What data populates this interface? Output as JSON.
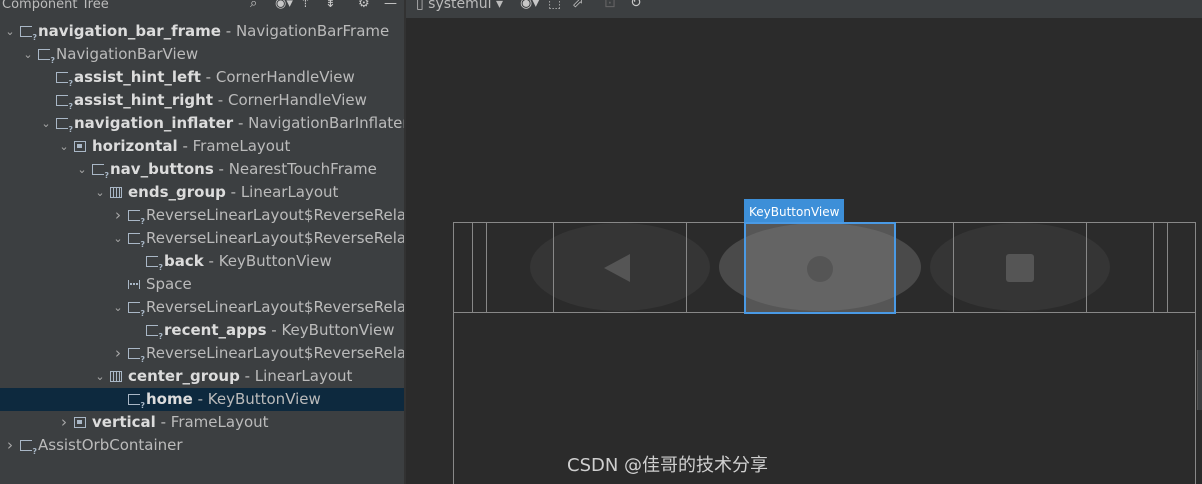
{
  "tree_panel": {
    "title": "Component Tree",
    "header_icons": [
      "search-icon",
      "eye-icon",
      "expand-all-icon",
      "collapse-all-icon",
      "gear-icon",
      "minimize-icon"
    ],
    "nodes": [
      {
        "id": "navigation_bar_frame",
        "type": "NavigationBarFrame",
        "depth": 0,
        "chevron": "down",
        "icon": "view"
      },
      {
        "id": "",
        "type": "NavigationBarView",
        "depth": 1,
        "chevron": "down",
        "icon": "view"
      },
      {
        "id": "assist_hint_left",
        "type": "CornerHandleView",
        "depth": 2,
        "chevron": "none",
        "icon": "view"
      },
      {
        "id": "assist_hint_right",
        "type": "CornerHandleView",
        "depth": 2,
        "chevron": "none",
        "icon": "view"
      },
      {
        "id": "navigation_inflater",
        "type": "NavigationBarInflaterV...",
        "depth": 2,
        "chevron": "down",
        "icon": "view"
      },
      {
        "id": "horizontal",
        "type": "FrameLayout",
        "depth": 3,
        "chevron": "down",
        "icon": "frame"
      },
      {
        "id": "nav_buttons",
        "type": "NearestTouchFrame",
        "depth": 4,
        "chevron": "down",
        "icon": "view"
      },
      {
        "id": "ends_group",
        "type": "LinearLayout",
        "depth": 5,
        "chevron": "down",
        "icon": "linear"
      },
      {
        "id": "",
        "type": "ReverseLinearLayout$ReverseRelat...",
        "depth": 6,
        "chevron": "right",
        "icon": "view"
      },
      {
        "id": "",
        "type": "ReverseLinearLayout$ReverseRelat...",
        "depth": 6,
        "chevron": "down",
        "icon": "view"
      },
      {
        "id": "back",
        "type": "KeyButtonView",
        "depth": 7,
        "chevron": "none",
        "icon": "view"
      },
      {
        "id": "",
        "type": "Space",
        "depth": 6,
        "chevron": "none",
        "icon": "space"
      },
      {
        "id": "",
        "type": "ReverseLinearLayout$ReverseRelat...",
        "depth": 6,
        "chevron": "down",
        "icon": "view"
      },
      {
        "id": "recent_apps",
        "type": "KeyButtonView",
        "depth": 7,
        "chevron": "none",
        "icon": "view"
      },
      {
        "id": "",
        "type": "ReverseLinearLayout$ReverseRelat...",
        "depth": 6,
        "chevron": "right",
        "icon": "view"
      },
      {
        "id": "center_group",
        "type": "LinearLayout",
        "depth": 5,
        "chevron": "down",
        "icon": "linear"
      },
      {
        "id": "home",
        "type": "KeyButtonView",
        "depth": 6,
        "chevron": "none",
        "icon": "view",
        "selected": true
      },
      {
        "id": "vertical",
        "type": "FrameLayout",
        "depth": 3,
        "chevron": "right",
        "icon": "frame"
      },
      {
        "id": "",
        "type": "AssistOrbContainer",
        "depth": 0,
        "chevron": "right",
        "icon": "view"
      }
    ]
  },
  "design_toolbar": {
    "device": "systemui",
    "icons": [
      "eye-icon",
      "layout-bounds-icon",
      "export-icon",
      "snapshot-icon",
      "refresh-icon"
    ]
  },
  "design_surface": {
    "selected_label": "KeyButtonView",
    "buttons": [
      "back-icon",
      "home-icon",
      "recent-apps-icon"
    ]
  },
  "watermark": "CSDN @佳哥的技术分享",
  "colors": {
    "panel_bg": "#3c3f41",
    "canvas_bg": "#2b2b2b",
    "selection_blue": "#3d8fd8",
    "tree_selected_bg": "#0d293e"
  }
}
